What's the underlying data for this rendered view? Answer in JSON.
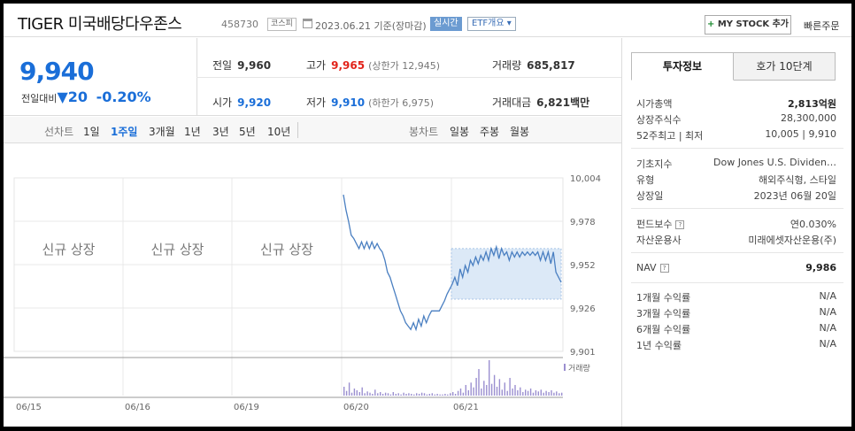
{
  "header": {
    "name": "TIGER 미국배당다우존스",
    "code": "458730",
    "market_badge": "코스피",
    "date": "2023.06.21 기준(장마감)",
    "realtime": "실시간",
    "etf_info": "ETF개요 ▾",
    "my_stock_plus": "+",
    "my_stock": "MY STOCK 추가",
    "quick_order": "빠른주문"
  },
  "summary": {
    "price": "9,940",
    "change_label": "전일대비",
    "change_arrow": "▼",
    "change_value": "20",
    "change_pct": "-0.20%",
    "prev_label": "전일",
    "prev_value": "9,960",
    "high_label": "고가",
    "high_value": "9,965",
    "upper_limit": "(상한가 12,945)",
    "volume_label": "거래량",
    "volume_value": "685,817",
    "open_label": "시가",
    "open_value": "9,920",
    "low_label": "저가",
    "low_value": "9,910",
    "lower_limit": "(하한가 6,975)",
    "amount_label": "거래대금",
    "amount_value": "6,821",
    "amount_unit": "백만"
  },
  "period": {
    "line_label": "선차트",
    "line_items": [
      "1일",
      "1주일",
      "3개월",
      "1년",
      "3년",
      "5년",
      "10년"
    ],
    "selected": "1주일",
    "candle_label": "봉차트",
    "candle_items": [
      "일봉",
      "주봉",
      "월봉"
    ]
  },
  "chart_data": {
    "type": "line",
    "x_labels": [
      "06/15",
      "06/16",
      "06/19",
      "06/20",
      "06/21"
    ],
    "y_ticks": [
      "10,004",
      "9,978",
      "9,952",
      "9,926",
      "9,901"
    ],
    "ylim": [
      9901,
      10004
    ],
    "new_listing_label": "신규 상장",
    "volume_label": "거래량",
    "highlight_low": 9932,
    "highlight_high": 9962,
    "prices": [
      9994,
      9985,
      9978,
      9970,
      9968,
      9965,
      9962,
      9966,
      9962,
      9966,
      9962,
      9966,
      9962,
      9965,
      9962,
      9960,
      9955,
      9948,
      9945,
      9940,
      9935,
      9930,
      9925,
      9922,
      9918,
      9916,
      9914,
      9918,
      9914,
      9920,
      9916,
      9922,
      9918,
      9922,
      9925,
      9925,
      9925,
      9925,
      9928,
      9931,
      9935,
      9938,
      9941,
      9945,
      9940,
      9950,
      9945,
      9952,
      9948,
      9955,
      9952,
      9957,
      9953,
      9958,
      9955,
      9960,
      9955,
      9962,
      9958,
      9963,
      9956,
      9962,
      9958,
      9960,
      9955,
      9960,
      9957,
      9960,
      9957,
      9960,
      9958,
      9960,
      9958,
      9960,
      9958,
      9960,
      9955,
      9960,
      9955,
      9960,
      9953,
      9960,
      9948,
      9945,
      9942
    ],
    "volumes": [
      15,
      8,
      22,
      5,
      12,
      9,
      6,
      14,
      4,
      7,
      5,
      3,
      10,
      4,
      6,
      3,
      5,
      4,
      2,
      6,
      3,
      4,
      2,
      5,
      3,
      4,
      3,
      2,
      4,
      3,
      5,
      4,
      2,
      3,
      4,
      2,
      3,
      2,
      2,
      3,
      2,
      4,
      6,
      3,
      8,
      12,
      5,
      18,
      9,
      22,
      14,
      30,
      45,
      12,
      25,
      18,
      60,
      20,
      35,
      15,
      28,
      10,
      22,
      8,
      30,
      12,
      18,
      9,
      14,
      6,
      10,
      8,
      12,
      5,
      9,
      7,
      10,
      5,
      8,
      6,
      9,
      5,
      7,
      4,
      5
    ]
  },
  "invest": {
    "tab_active": "투자정보",
    "tab_inactive": "호가 10단계",
    "rows1": [
      {
        "label": "시가총액",
        "value": "2,813억원",
        "bold": true
      },
      {
        "label": "상장주식수",
        "value": "28,300,000",
        "bold": false
      },
      {
        "label": "52주최고 | 최저",
        "value": "10,005 | 9,910",
        "bold": false
      }
    ],
    "rows2": [
      {
        "label": "기초지수",
        "value": "Dow Jones U.S. Dividen…"
      },
      {
        "label": "유형",
        "value": "해외주식형, 스타일"
      },
      {
        "label": "상장일",
        "value": "2023년 06월 20일"
      }
    ],
    "fee_label": "펀드보수",
    "fee_value": "연0.030%",
    "manager_label": "자산운용사",
    "manager_value": "미래에셋자산운용(주)",
    "nav_label": "NAV",
    "nav_value": "9,986",
    "returns": [
      {
        "label": "1개월 수익률",
        "value": "N/A"
      },
      {
        "label": "3개월 수익률",
        "value": "N/A"
      },
      {
        "label": "6개월 수익률",
        "value": "N/A"
      },
      {
        "label": "1년 수익률",
        "value": "N/A"
      }
    ]
  },
  "colors": {
    "blue": "#1a6ed8",
    "red": "#e2231a",
    "line": "#4a7fc1",
    "highlight": "#dce9f7",
    "volume": "#9b8fd0"
  }
}
